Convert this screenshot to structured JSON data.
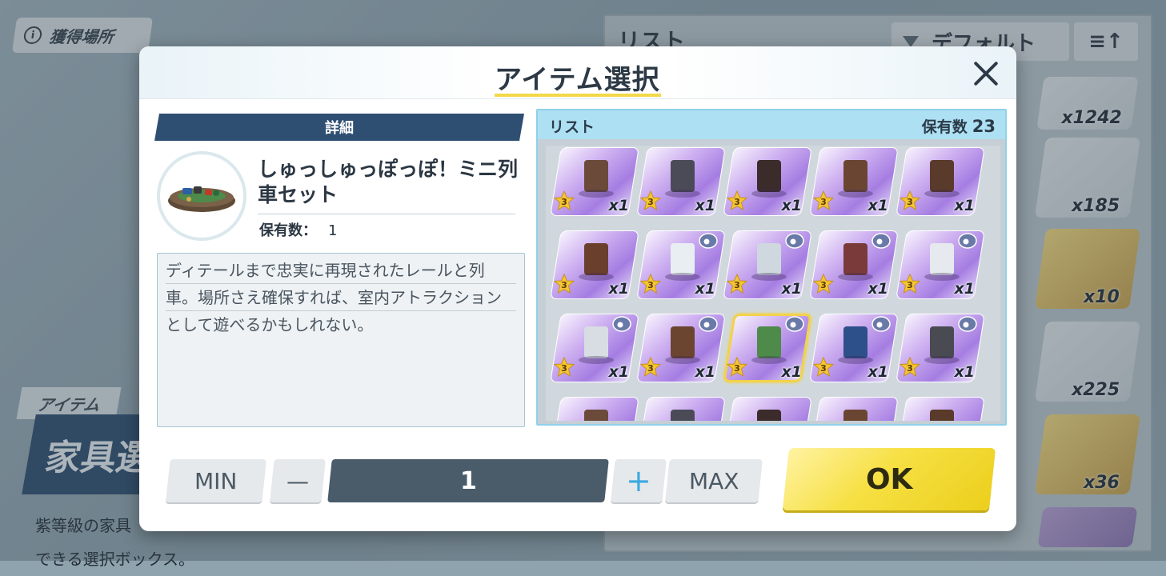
{
  "background": {
    "source_button": "獲得場所",
    "item_tag": "アイテム",
    "title_fragment": "家具選",
    "desc_lines": [
      "紫等級の家具",
      "できる選択ボックス。"
    ],
    "list_title": "リスト",
    "filter_label": "デフォルト",
    "sort_label": "≡↑",
    "grid_quantities": [
      "x1242",
      "x185",
      "x10",
      "x225",
      "x36"
    ]
  },
  "modal": {
    "title": "アイテム選択",
    "close_icon": "close-icon",
    "detail_tab": "詳細",
    "item": {
      "name": "しゅっしゅっぽっぽ！ミニ列車セット",
      "owned_label": "保有数：",
      "owned_value": "1",
      "description_lines": [
        "ディテールまで忠実に再現されたレールと列",
        "車。場所さえ確保すれば、室内アトラクション",
        "として遊べるかもしれない。"
      ]
    },
    "list": {
      "title": "リスト",
      "count_label": "保有数",
      "count_value": "23",
      "items": [
        {
          "icon": "painting-set-icon",
          "rarity": "3",
          "qty": "x1",
          "bubble": false
        },
        {
          "icon": "bird-statue-icon",
          "rarity": "3",
          "qty": "x1",
          "bubble": false
        },
        {
          "icon": "wall-banner-icon",
          "rarity": "3",
          "qty": "x1",
          "bubble": false
        },
        {
          "icon": "arched-window-icon",
          "rarity": "3",
          "qty": "x1",
          "bubble": false
        },
        {
          "icon": "bookshelf-icon",
          "rarity": "3",
          "qty": "x1",
          "bubble": false
        },
        {
          "icon": "tall-cabinet-icon",
          "rarity": "3",
          "qty": "x1",
          "bubble": false
        },
        {
          "icon": "snowman-table-icon",
          "rarity": "3",
          "qty": "x1",
          "bubble": true
        },
        {
          "icon": "bench-table-icon",
          "rarity": "3",
          "qty": "x1",
          "bubble": true
        },
        {
          "icon": "net-stand-icon",
          "rarity": "3",
          "qty": "x1",
          "bubble": true
        },
        {
          "icon": "exercise-machine-icon",
          "rarity": "3",
          "qty": "x1",
          "bubble": true
        },
        {
          "icon": "mirror-stand-icon",
          "rarity": "3",
          "qty": "x1",
          "bubble": true
        },
        {
          "icon": "jukebox-icon",
          "rarity": "3",
          "qty": "x1",
          "bubble": true
        },
        {
          "icon": "mini-train-icon",
          "rarity": "3",
          "qty": "x1",
          "bubble": true,
          "selected": true
        },
        {
          "icon": "speaker-set-icon",
          "rarity": "3",
          "qty": "x1",
          "bubble": true
        },
        {
          "icon": "retro-tv-icon",
          "rarity": "3",
          "qty": "x1",
          "bubble": true
        }
      ]
    },
    "controls": {
      "min_label": "MIN",
      "minus_label": "—",
      "quantity": "1",
      "plus_label": "+",
      "max_label": "MAX",
      "ok_label": "OK"
    },
    "colors": {
      "accent_yellow": "#f3d84a",
      "header_navy": "#2f4f72",
      "list_blue": "#aee0f3",
      "card_purple": "#a57de2"
    }
  }
}
